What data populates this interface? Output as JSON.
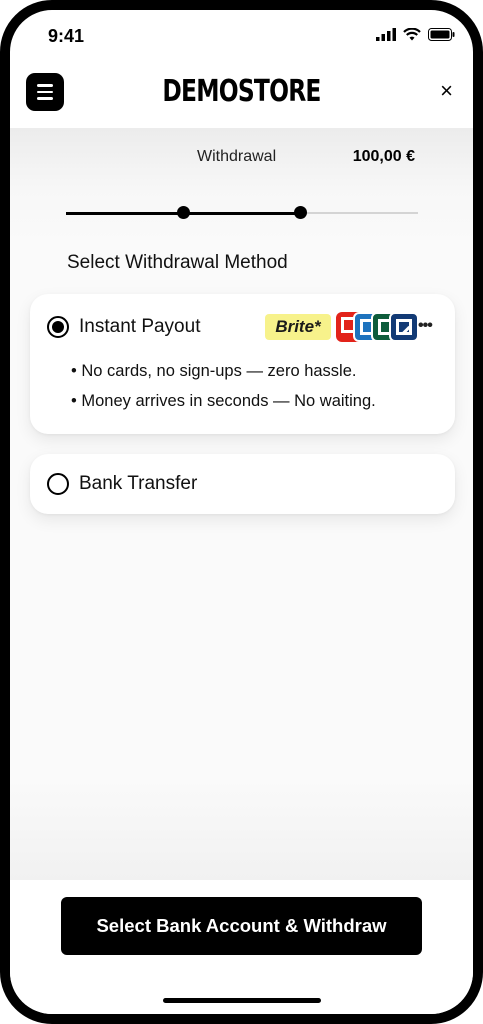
{
  "status_bar": {
    "time": "9:41",
    "icons": [
      "signal-icon",
      "wifi-icon",
      "battery-icon"
    ]
  },
  "header": {
    "menu_icon": "hamburger-menu-icon",
    "brand": "DEMOSTORE",
    "close": "×"
  },
  "withdrawal": {
    "label": "Withdrawal",
    "amount": "100,00 €",
    "progress_step": 2,
    "progress_total": 3
  },
  "section_title": "Select Withdrawal Method",
  "methods": [
    {
      "label": "Instant Payout",
      "selected": true,
      "brand_logo": "Brite*",
      "bank_logos": [
        "bank-logo-red",
        "bank-logo-blue",
        "bank-logo-green",
        "bank-logo-navy"
      ],
      "more": "•••",
      "bullets": [
        "• No cards, no sign-ups — zero hassle.",
        "• Money arrives in seconds — No waiting."
      ]
    },
    {
      "label": "Bank Transfer",
      "selected": false
    }
  ],
  "cta_label": "Select Bank Account & Withdraw",
  "colors": {
    "accent": "#000000",
    "brite_bg": "#f7f28b",
    "background": "#fafafa"
  }
}
